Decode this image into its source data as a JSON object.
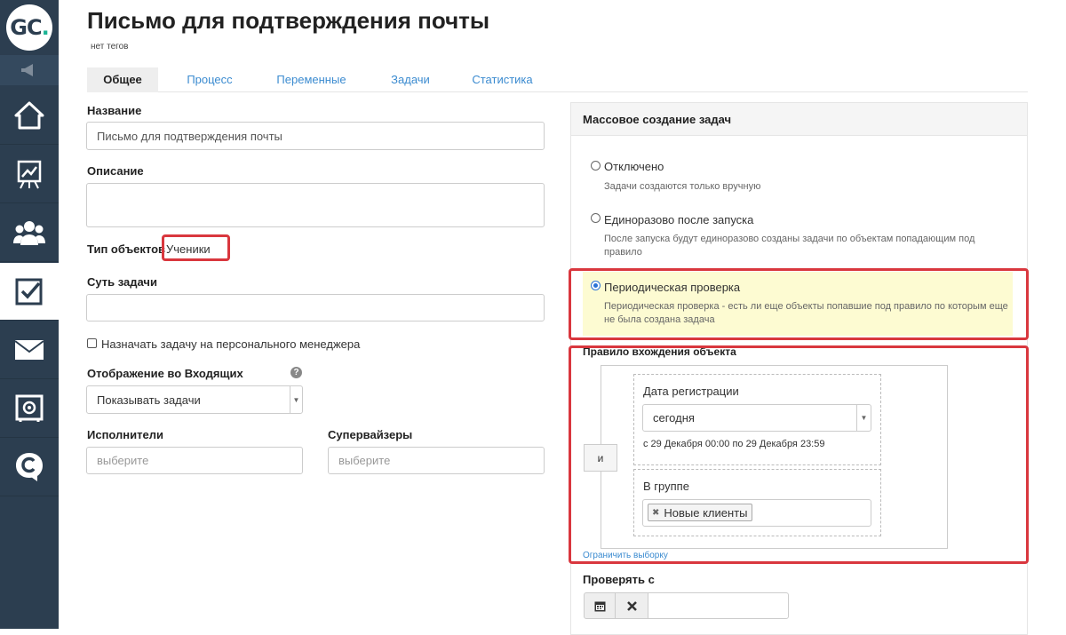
{
  "sidebar": {
    "logo": {
      "text": "GC",
      "dot": "."
    },
    "items": [
      {
        "icon": "home-icon",
        "active": false
      },
      {
        "icon": "chart-easel-icon",
        "active": false
      },
      {
        "icon": "users-icon",
        "active": false
      },
      {
        "icon": "task-check-icon",
        "active": true
      },
      {
        "icon": "mail-icon",
        "active": false
      },
      {
        "icon": "safe-icon",
        "active": false
      },
      {
        "icon": "chat-c-icon",
        "active": false
      }
    ]
  },
  "page": {
    "title": "Письмо для подтверждения почты",
    "tags": "нет тегов"
  },
  "tabs": [
    {
      "label": "Общее",
      "active": true
    },
    {
      "label": "Процесс",
      "active": false
    },
    {
      "label": "Переменные",
      "active": false
    },
    {
      "label": "Задачи",
      "active": false
    },
    {
      "label": "Статистика",
      "active": false
    }
  ],
  "form": {
    "name_label": "Название",
    "name_value": "Письмо для подтверждения почты",
    "description_label": "Описание",
    "description_value": "",
    "object_type_label": "Тип объектов",
    "object_type_value": "Ученики",
    "task_essence_label": "Суть задачи",
    "task_essence_value": "",
    "assign_manager_label": "Назначать задачу на персонального менеджера",
    "inbox_display_label": "Отображение во Входящих",
    "inbox_display_value": "Показывать задачи",
    "help_glyph": "?",
    "executors_label": "Исполнители",
    "executors_placeholder": "выберите",
    "supervisors_label": "Супервайзеры",
    "supervisors_placeholder": "выберите"
  },
  "mass_tasks": {
    "title": "Массовое создание задач",
    "options": [
      {
        "label": "Отключено",
        "desc": "Задачи создаются только вручную",
        "selected": false
      },
      {
        "label": "Единоразово после запуска",
        "desc": "После запуска будут единоразово созданы задачи по объектам попадающим под правило",
        "selected": false
      },
      {
        "label": "Периодическая проверка",
        "desc": "Периодическая проверка - есть ли еще объекты попавшие под правило по которым еще не была создана задача",
        "selected": true
      }
    ]
  },
  "rule": {
    "title": "Правило вхождения объекта",
    "and_label": "и",
    "reg_date_label": "Дата регистрации",
    "reg_date_value": "сегодня",
    "reg_date_range": "с 29 Декабря 00:00 по 29 Декабря 23:59",
    "group_label": "В группе",
    "group_tag": "Новые клиенты",
    "limit_link": "Ограничить выборку"
  },
  "check_from": {
    "label": "Проверять с",
    "value": ""
  },
  "colors": {
    "sidebar": "#2c3e50",
    "link": "#3b8bd0",
    "annotation": "#d9373e",
    "highlight": "#fdfbd2"
  }
}
